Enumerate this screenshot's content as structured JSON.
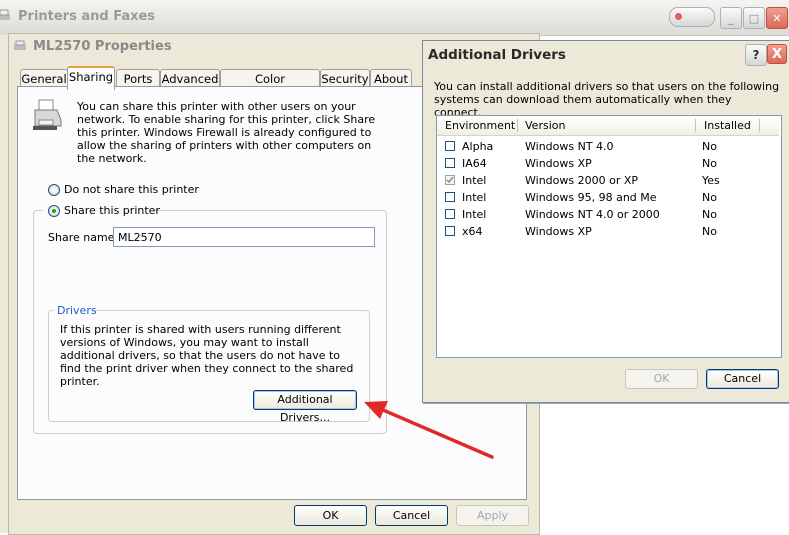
{
  "background_window": {
    "title": "Printers and Faxes"
  },
  "properties": {
    "title": "ML2570 Properties",
    "tabs": [
      "General",
      "Sharing",
      "Ports",
      "Advanced",
      "Color Management",
      "Security",
      "About"
    ],
    "active_tab": "Sharing",
    "intro_text": "You can share this printer with other users on your network.  To enable sharing for this printer, click Share this printer.  Windows Firewall is already configured to allow the sharing of printers with other computers on the network.",
    "radio_not_share": "Do not share this printer",
    "radio_share": "Share this printer",
    "share_name_label": "Share name:",
    "share_name_value": "ML2570",
    "drivers_group_label": "Drivers",
    "drivers_text": "If this printer is shared with users running different versions of Windows, you may want to install additional drivers, so that the users do not have to find the print driver when they connect to the shared printer.",
    "additional_drivers_button": "Additional Drivers...",
    "ok": "OK",
    "cancel": "Cancel",
    "apply": "Apply"
  },
  "additional_drivers": {
    "title": "Additional Drivers",
    "help": "?",
    "close": "X",
    "description": "You can install additional drivers so that users on the following systems can download them automatically when they connect.",
    "columns": [
      "Environment",
      "Version",
      "Installed"
    ],
    "rows": [
      {
        "environment": "Alpha",
        "version": "Windows NT 4.0",
        "installed": "No",
        "checked": false
      },
      {
        "environment": "IA64",
        "version": "Windows XP",
        "installed": "No",
        "checked": false
      },
      {
        "environment": "Intel",
        "version": "Windows 2000 or XP",
        "installed": "Yes",
        "checked": true
      },
      {
        "environment": "Intel",
        "version": "Windows 95, 98 and Me",
        "installed": "No",
        "checked": false
      },
      {
        "environment": "Intel",
        "version": "Windows NT 4.0 or 2000",
        "installed": "No",
        "checked": false
      },
      {
        "environment": "x64",
        "version": "Windows XP",
        "installed": "No",
        "checked": false
      }
    ],
    "ok": "OK",
    "cancel": "Cancel"
  },
  "colors": {
    "arrow": "#e02a2a",
    "accent_tab": "#e8a23a",
    "radio_dot": "#21a121"
  }
}
